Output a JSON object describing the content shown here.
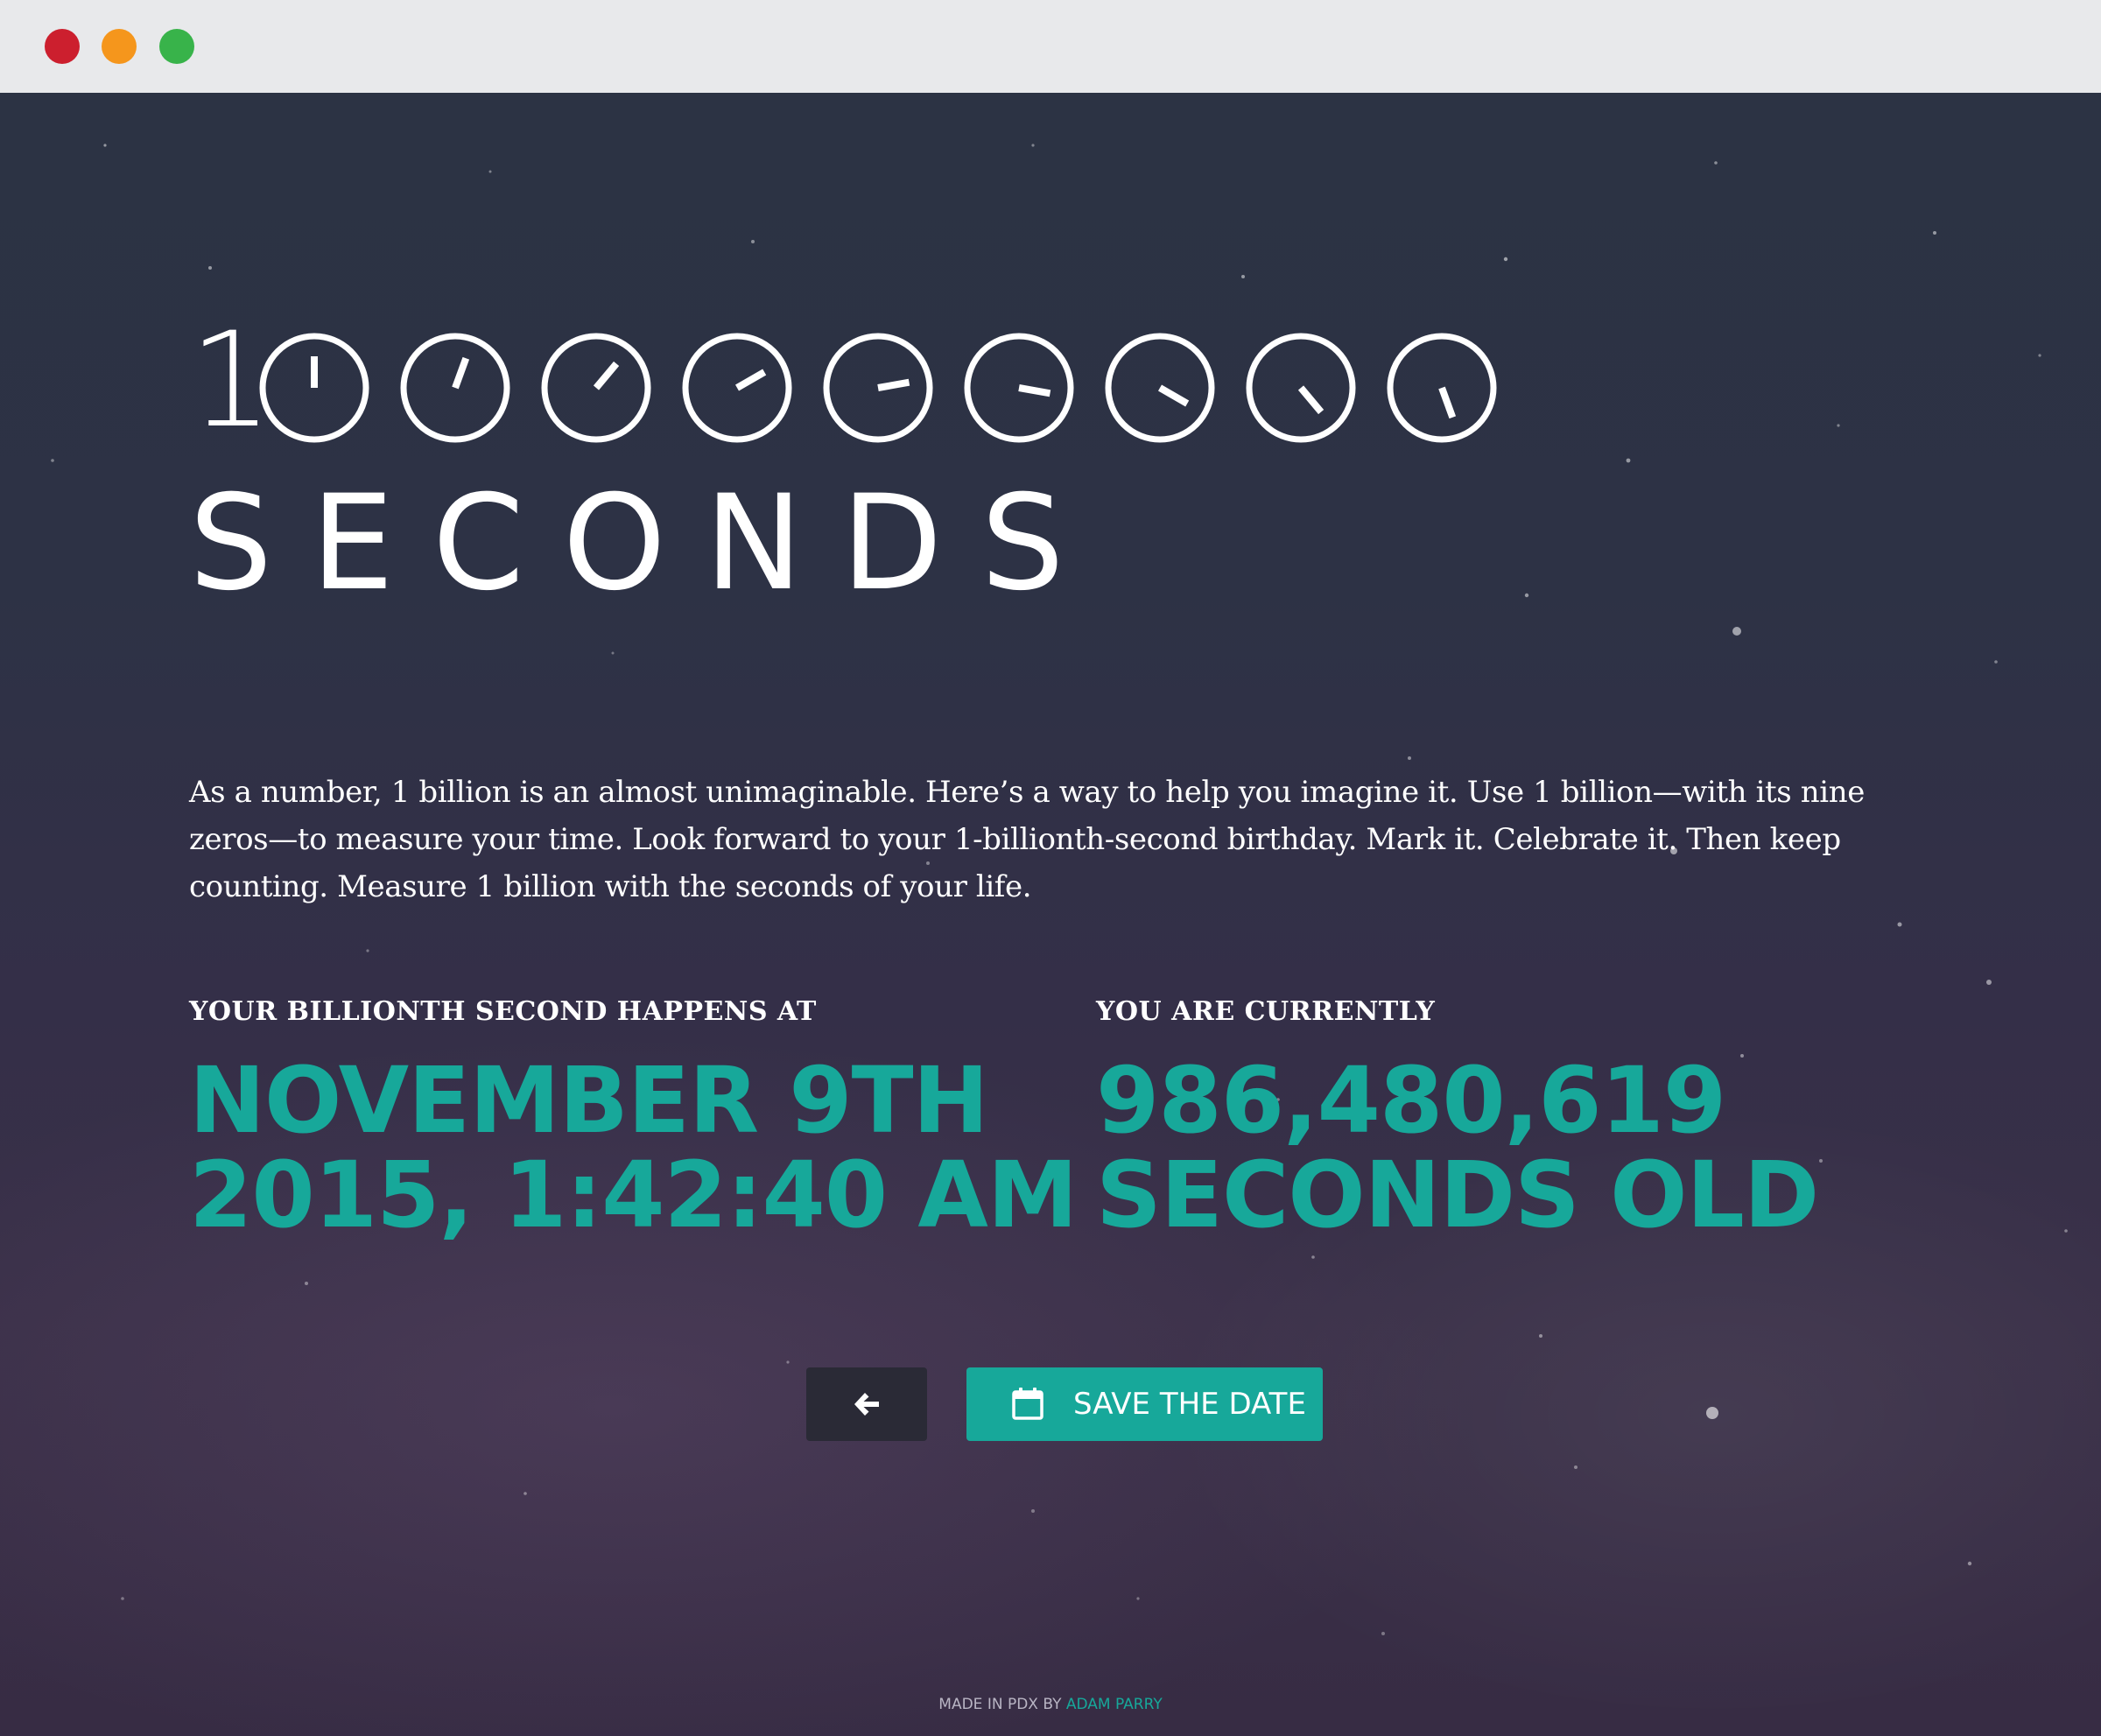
{
  "hero": {
    "leading_digit": "1",
    "dial_count": 9,
    "word": "SECONDS"
  },
  "intro": {
    "text": "As a number, 1 billion is an almost unimaginable. Here’s a way to help you imagine it. Use 1 billion—with its nine zeros—to measure your time. Look forward to your 1-billionth-second birthday. Mark it. Celebrate it. Then keep counting. Measure 1 billion with the seconds of your life."
  },
  "billionth": {
    "label": "YOUR BILLIONTH SECOND HAPPENS AT",
    "line1": "NOVEMBER 9TH",
    "line2": "2015, 1:42:40 AM"
  },
  "current": {
    "label": "YOU ARE CURRENTLY",
    "line1": "986,480,619",
    "line2": "SECONDS OLD"
  },
  "actions": {
    "back_icon": "arrow-left-icon",
    "save_icon": "calendar-icon",
    "save_label": "SAVE THE DATE"
  },
  "footer": {
    "prefix": "MADE IN PDX BY",
    "author": "ADAM PARRY"
  },
  "colors": {
    "accent": "#17a89a",
    "back_button": "#2a2a36",
    "text": "#ffffff"
  }
}
